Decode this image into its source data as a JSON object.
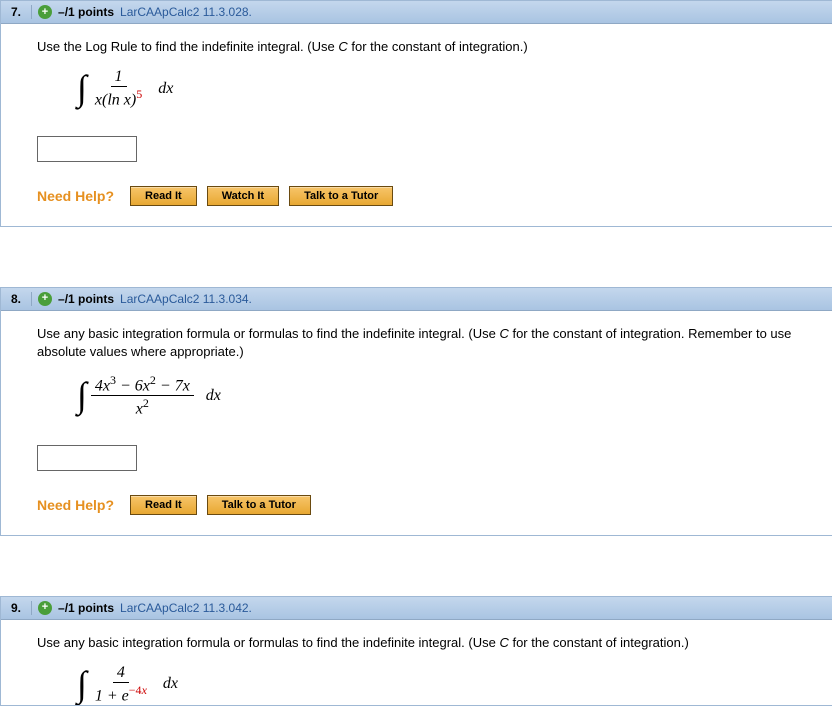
{
  "questions": [
    {
      "number": "7.",
      "points": "–/1 points",
      "ref": "LarCAApCalc2 11.3.028.",
      "prompt_pre": "Use the Log Rule to find the indefinite integral. (Use ",
      "prompt_var": "C",
      "prompt_post": " for the constant of integration.)",
      "help": {
        "read": "Read It",
        "watch": "Watch It",
        "tutor": "Talk to a Tutor"
      }
    },
    {
      "number": "8.",
      "points": "–/1 points",
      "ref": "LarCAApCalc2 11.3.034.",
      "prompt_pre": "Use any basic integration formula or formulas to find the indefinite integral. (Use ",
      "prompt_var": "C",
      "prompt_post": " for the constant of integration. Remember to use absolute values where appropriate.)",
      "help": {
        "read": "Read It",
        "tutor": "Talk to a Tutor"
      }
    },
    {
      "number": "9.",
      "points": "–/1 points",
      "ref": "LarCAApCalc2 11.3.042.",
      "prompt_pre": "Use any basic integration formula or formulas to find the indefinite integral. (Use ",
      "prompt_var": "C",
      "prompt_post": " for the constant of integration.)"
    }
  ],
  "help_label": "Need Help?",
  "dx": "dx"
}
